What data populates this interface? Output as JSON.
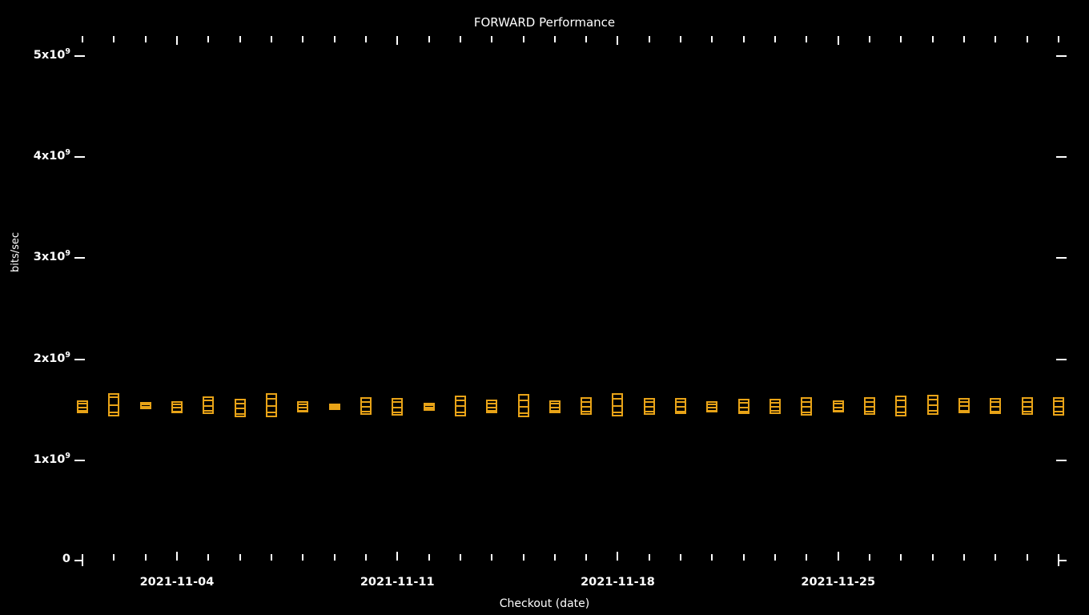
{
  "chart_data": {
    "type": "bar",
    "subtype": "candlestick-boxplot",
    "title": "FORWARD Performance",
    "xlabel": "Checkout (date)",
    "ylabel": "bits/sec",
    "grid": false,
    "legend": false,
    "background_color": "#000000",
    "foreground_color": "#ffffff",
    "series_color": "#e8a317",
    "ylim": [
      0,
      5400000000
    ],
    "ytick_labels": [
      "0",
      "1x10⁹",
      "2x10⁹",
      "3x10⁹",
      "4x10⁹",
      "5x10⁹"
    ],
    "ytick_values": [
      0,
      1000000000,
      2000000000,
      3000000000,
      4000000000,
      5000000000
    ],
    "xtick_labels": [
      "2021-11-04",
      "2021-11-11",
      "2021-11-18",
      "2021-11-25"
    ],
    "xtick_values": [
      "2021-11-04",
      "2021-11-11",
      "2021-11-18",
      "2021-11-25"
    ],
    "xlim": [
      "2021-11-01",
      "2021-11-30"
    ],
    "points": [
      {
        "x": "2021-11-01",
        "low": 1455000000,
        "q1": 1490000000,
        "median": 1525000000,
        "q3": 1560000000,
        "high": 1585000000
      },
      {
        "x": "2021-11-02",
        "low": 1430000000,
        "q1": 1475000000,
        "median": 1545000000,
        "q3": 1625000000,
        "high": 1660000000
      },
      {
        "x": "2021-11-03",
        "low": 1495000000,
        "q1": 1510000000,
        "median": 1530000000,
        "q3": 1550000000,
        "high": 1565000000
      },
      {
        "x": "2021-11-04",
        "low": 1455000000,
        "q1": 1485000000,
        "median": 1520000000,
        "q3": 1555000000,
        "high": 1580000000
      },
      {
        "x": "2021-11-05",
        "low": 1450000000,
        "q1": 1490000000,
        "median": 1540000000,
        "q3": 1590000000,
        "high": 1625000000
      },
      {
        "x": "2021-11-06",
        "low": 1420000000,
        "q1": 1460000000,
        "median": 1510000000,
        "q3": 1560000000,
        "high": 1600000000
      },
      {
        "x": "2021-11-07",
        "low": 1415000000,
        "q1": 1470000000,
        "median": 1540000000,
        "q3": 1610000000,
        "high": 1655000000
      },
      {
        "x": "2021-11-08",
        "low": 1465000000,
        "q1": 1490000000,
        "median": 1520000000,
        "q3": 1550000000,
        "high": 1575000000
      },
      {
        "x": "2021-11-09",
        "low": 1490000000,
        "q1": 1505000000,
        "median": 1522000000,
        "q3": 1540000000,
        "high": 1552000000
      },
      {
        "x": "2021-11-10",
        "low": 1440000000,
        "q1": 1480000000,
        "median": 1530000000,
        "q3": 1580000000,
        "high": 1615000000
      },
      {
        "x": "2021-11-11",
        "low": 1435000000,
        "q1": 1475000000,
        "median": 1525000000,
        "q3": 1575000000,
        "high": 1610000000
      },
      {
        "x": "2021-11-12",
        "low": 1485000000,
        "q1": 1502000000,
        "median": 1522000000,
        "q3": 1542000000,
        "high": 1558000000
      },
      {
        "x": "2021-11-13",
        "low": 1430000000,
        "q1": 1475000000,
        "median": 1535000000,
        "q3": 1595000000,
        "high": 1635000000
      },
      {
        "x": "2021-11-14",
        "low": 1455000000,
        "q1": 1488000000,
        "median": 1525000000,
        "q3": 1562000000,
        "high": 1592000000
      },
      {
        "x": "2021-11-15",
        "low": 1415000000,
        "q1": 1465000000,
        "median": 1530000000,
        "q3": 1595000000,
        "high": 1645000000
      },
      {
        "x": "2021-11-16",
        "low": 1460000000,
        "q1": 1490000000,
        "median": 1525000000,
        "q3": 1560000000,
        "high": 1588000000
      },
      {
        "x": "2021-11-17",
        "low": 1440000000,
        "q1": 1478000000,
        "median": 1528000000,
        "q3": 1578000000,
        "high": 1615000000
      },
      {
        "x": "2021-11-18",
        "low": 1425000000,
        "q1": 1472000000,
        "median": 1538000000,
        "q3": 1605000000,
        "high": 1655000000
      },
      {
        "x": "2021-11-19",
        "low": 1445000000,
        "q1": 1482000000,
        "median": 1528000000,
        "q3": 1575000000,
        "high": 1610000000
      },
      {
        "x": "2021-11-20",
        "low": 1450000000,
        "q1": 1485000000,
        "median": 1530000000,
        "q3": 1575000000,
        "high": 1608000000
      },
      {
        "x": "2021-11-21",
        "low": 1468000000,
        "q1": 1492000000,
        "median": 1522000000,
        "q3": 1552000000,
        "high": 1575000000
      },
      {
        "x": "2021-11-22",
        "low": 1448000000,
        "q1": 1482000000,
        "median": 1525000000,
        "q3": 1568000000,
        "high": 1600000000
      },
      {
        "x": "2021-11-23",
        "low": 1452000000,
        "q1": 1486000000,
        "median": 1528000000,
        "q3": 1570000000,
        "high": 1602000000
      },
      {
        "x": "2021-11-24",
        "low": 1435000000,
        "q1": 1476000000,
        "median": 1528000000,
        "q3": 1580000000,
        "high": 1620000000
      },
      {
        "x": "2021-11-25",
        "low": 1462000000,
        "q1": 1490000000,
        "median": 1525000000,
        "q3": 1560000000,
        "high": 1585000000
      },
      {
        "x": "2021-11-26",
        "low": 1440000000,
        "q1": 1480000000,
        "median": 1530000000,
        "q3": 1580000000,
        "high": 1618000000
      },
      {
        "x": "2021-11-27",
        "low": 1428000000,
        "q1": 1472000000,
        "median": 1532000000,
        "q3": 1592000000,
        "high": 1635000000
      },
      {
        "x": "2021-11-28",
        "low": 1442000000,
        "q1": 1486000000,
        "median": 1542000000,
        "q3": 1598000000,
        "high": 1640000000
      },
      {
        "x": "2021-11-29",
        "low": 1455000000,
        "q1": 1490000000,
        "median": 1534000000,
        "q3": 1578000000,
        "high": 1612000000
      },
      {
        "x": "2021-11-30",
        "low": 1450000000,
        "q1": 1485000000,
        "median": 1530000000,
        "q3": 1575000000,
        "high": 1608000000
      },
      {
        "x": "2021-12-01",
        "low": 1446000000,
        "q1": 1484000000,
        "median": 1532000000,
        "q3": 1580000000,
        "high": 1614000000
      },
      {
        "x": "2021-12-02",
        "low": 1438000000,
        "q1": 1478000000,
        "median": 1530000000,
        "q3": 1582000000,
        "high": 1620000000
      }
    ]
  }
}
